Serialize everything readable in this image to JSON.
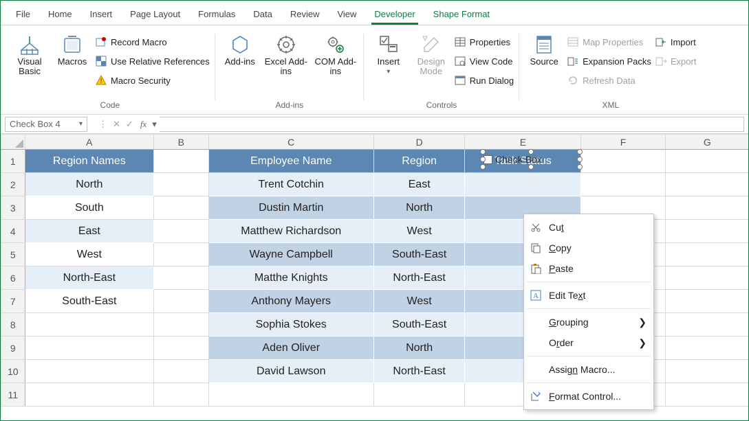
{
  "menubar": {
    "tabs": [
      "File",
      "Home",
      "Insert",
      "Page Layout",
      "Formulas",
      "Data",
      "Review",
      "View",
      "Developer",
      "Shape Format"
    ],
    "active": "Developer"
  },
  "ribbon": {
    "groups": {
      "code": {
        "label": "Code",
        "visual_basic": "Visual Basic",
        "macros": "Macros",
        "record_macro": "Record Macro",
        "use_rel_refs": "Use Relative References",
        "macro_security": "Macro Security"
      },
      "addins": {
        "label": "Add-ins",
        "addins": "Add-ins",
        "excel_addins": "Excel Add-ins",
        "com_addins": "COM Add-ins"
      },
      "controls": {
        "label": "Controls",
        "insert": "Insert",
        "design_mode": "Design Mode",
        "properties": "Properties",
        "view_code": "View Code",
        "run_dialog": "Run Dialog"
      },
      "xml": {
        "label": "XML",
        "source": "Source",
        "map_properties": "Map Properties",
        "expansion_packs": "Expansion Packs",
        "refresh_data": "Refresh Data",
        "import": "Import",
        "export": "Export"
      }
    }
  },
  "formulabar": {
    "namebox": "Check Box 4",
    "fx_label": "fx"
  },
  "grid": {
    "col_headers": [
      "A",
      "B",
      "C",
      "D",
      "E",
      "F",
      "G"
    ],
    "row_headers": [
      "1",
      "2",
      "3",
      "4",
      "5",
      "6",
      "7",
      "8",
      "9",
      "10",
      "11"
    ],
    "data": {
      "A1": "Region Names",
      "A2": "North",
      "A3": "South",
      "A4": "East",
      "A5": "West",
      "A6": "North-East",
      "A7": "South-East",
      "C1": "Employee Name",
      "C2": "Trent Cotchin",
      "C3": "Dustin Martin",
      "C4": "Matthew Richardson",
      "C5": "Wayne Campbell",
      "C6": "Matthe Knights",
      "C7": "Anthony Mayers",
      "C8": "Sophia Stokes",
      "C9": "Aden Oliver",
      "C10": "David Lawson",
      "D1": "Region",
      "D2": "East",
      "D3": "North",
      "D4": "West",
      "D5": "South-East",
      "D6": "North-East",
      "D7": "West",
      "D8": "South-East",
      "D9": "North",
      "D10": "North-East",
      "E1": "Task Status"
    }
  },
  "checkbox_shape": {
    "label": "Check Box"
  },
  "context_menu": {
    "cut": "Cut",
    "copy": "Copy",
    "paste": "Paste",
    "edit_text": "Edit Text",
    "grouping": "Grouping",
    "order": "Order",
    "assign_macro": "Assign Macro...",
    "format_control": "Format Control..."
  }
}
